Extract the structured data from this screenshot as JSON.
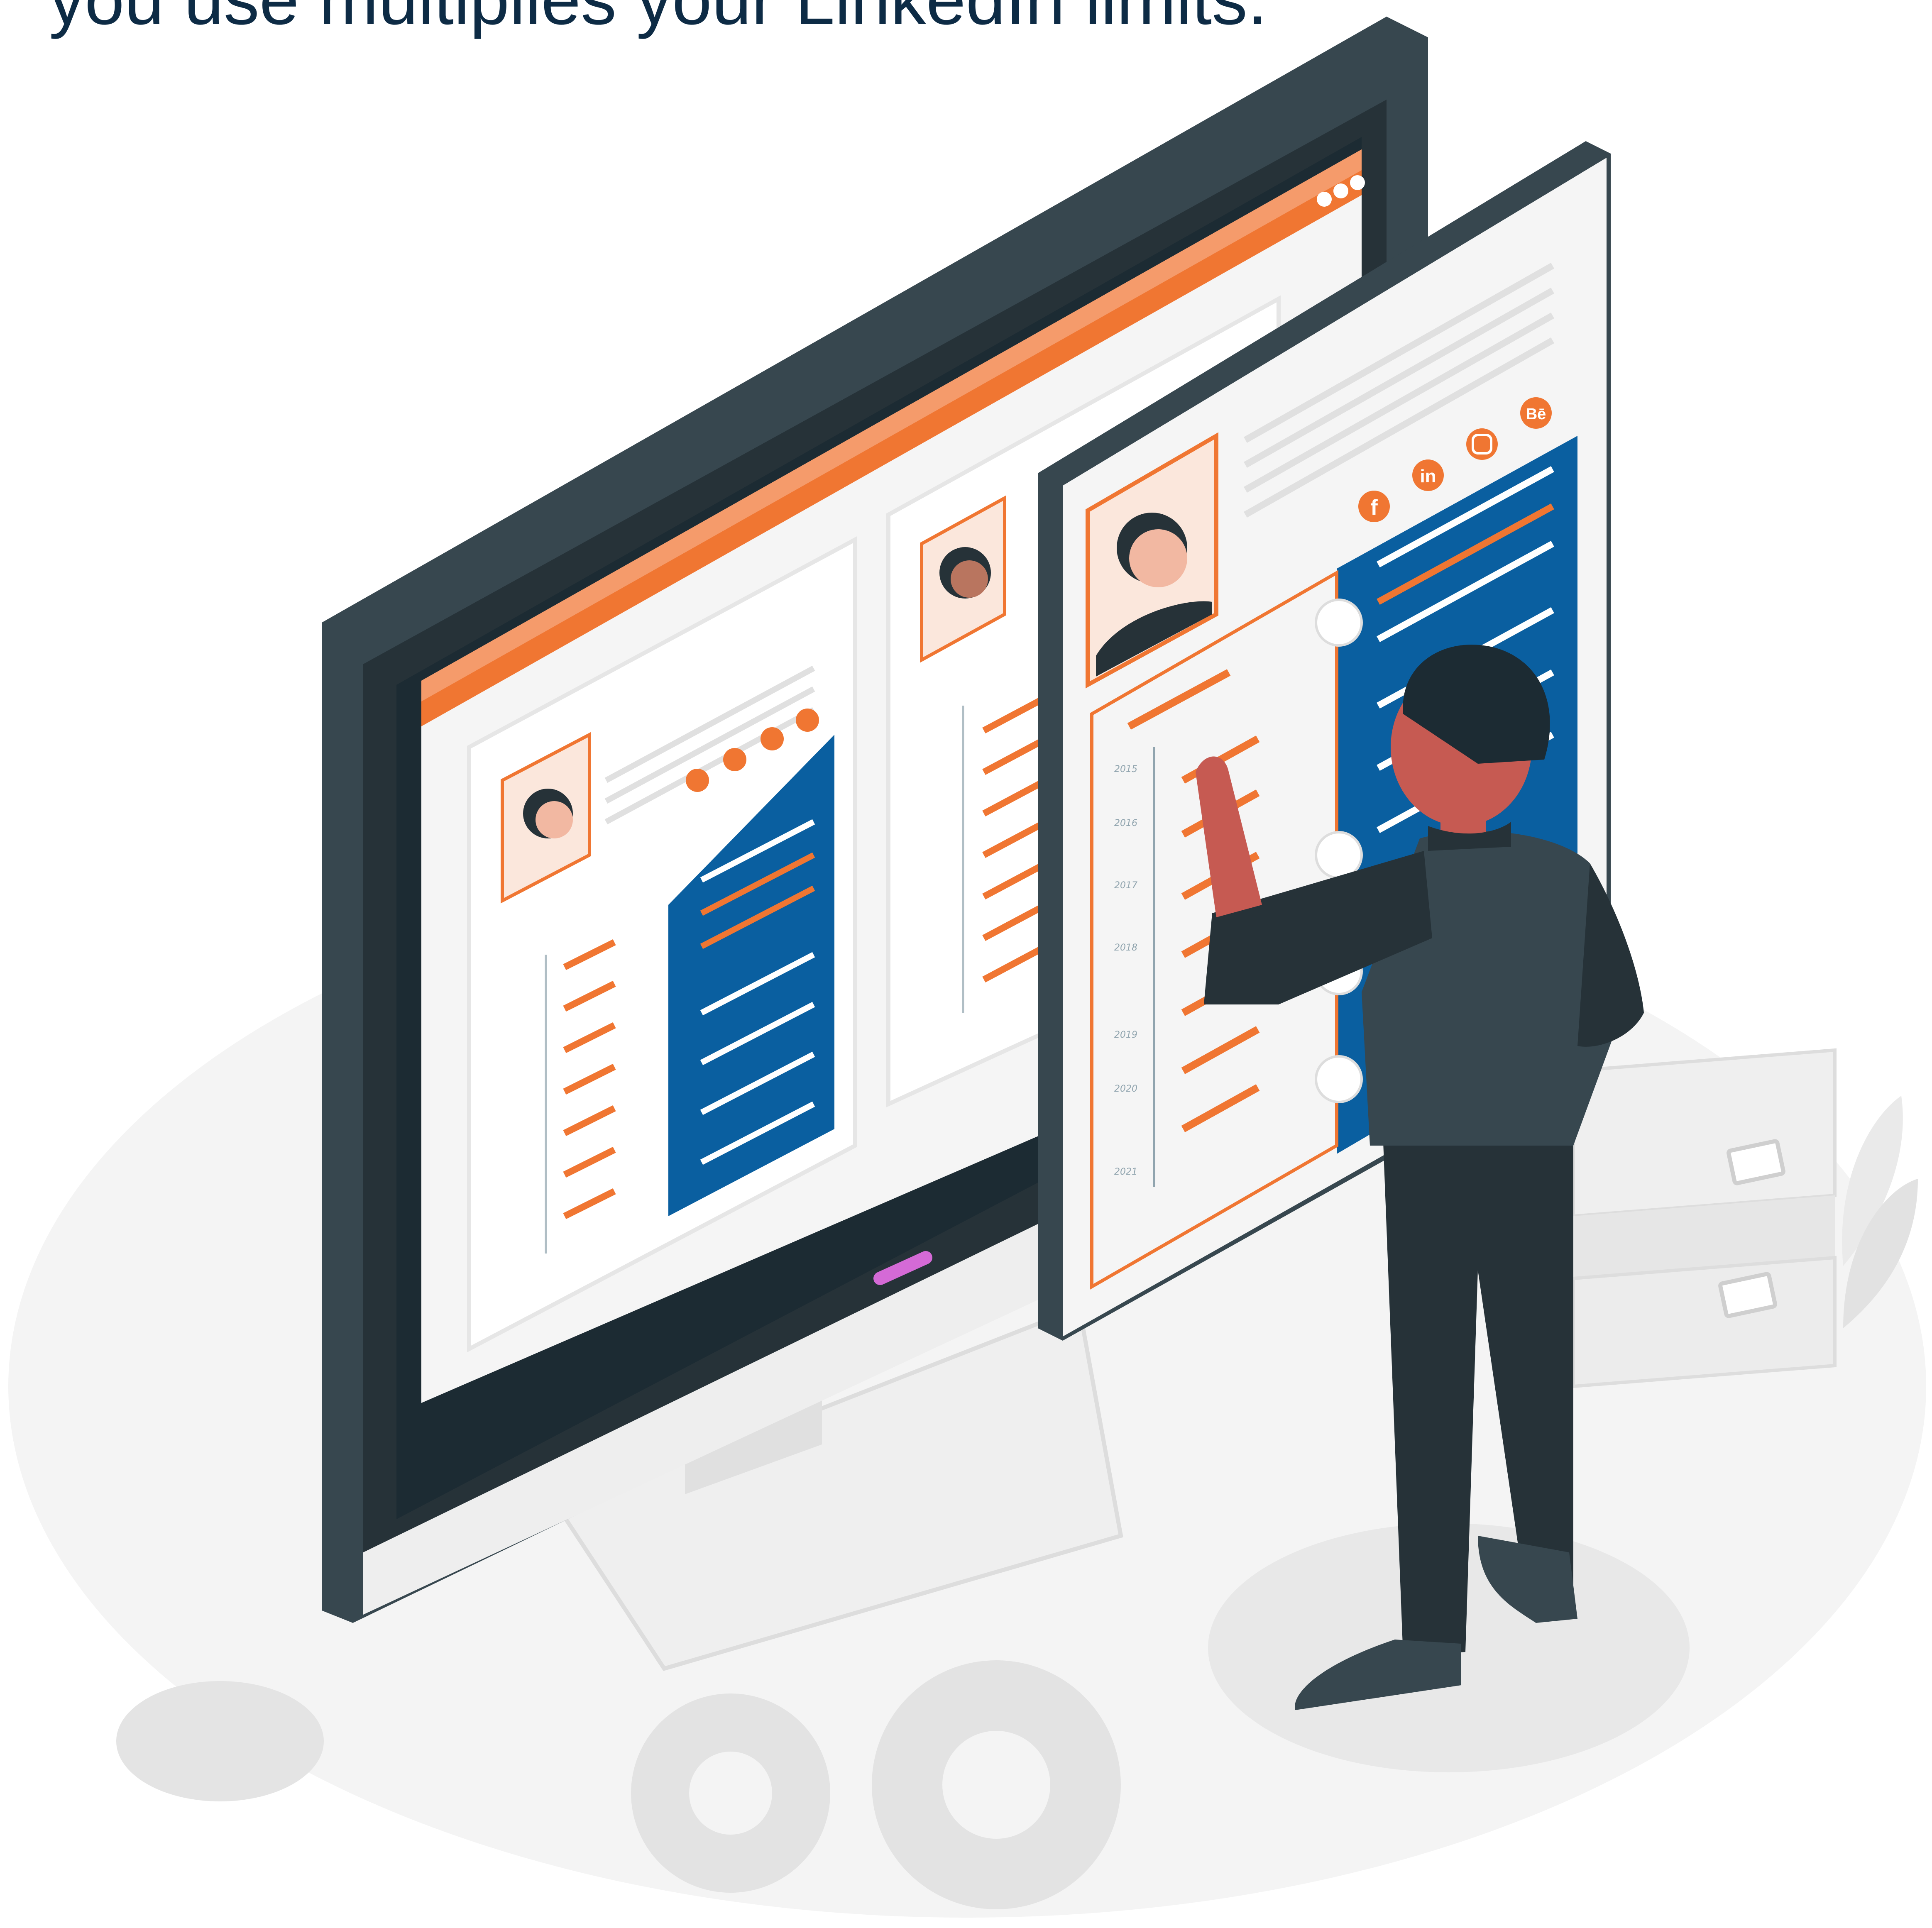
{
  "caption": {
    "text": "you use multiplies your LinkedIn limits.",
    "color": "#0d2b45"
  },
  "colors": {
    "monitor_frame": "#37474f",
    "monitor_dark": "#263238",
    "monitor_bezel": "#1c2b33",
    "accent_orange": "#f07632",
    "accent_orange_light": "#f59b6b",
    "resume_blue": "#0a5fa0",
    "page_white": "#f5f5f5",
    "line_gray": "#e0e0e0",
    "floor": "#f4f4f4",
    "skin": "#c65a52",
    "indicator": "#d46ad6"
  },
  "timeline_years": [
    "2015",
    "2016",
    "2017",
    "2018",
    "2019",
    "2020",
    "2021"
  ],
  "social_icons": [
    "facebook-icon",
    "linkedin-icon",
    "instagram-icon",
    "behance-icon"
  ],
  "skill_icons": [
    "pencil-icon",
    "lightbulb-icon",
    "gear-icon",
    "speech-bubble-icon"
  ],
  "social": {
    "facebook": "f",
    "linkedin": "in",
    "behance": "Bē"
  }
}
